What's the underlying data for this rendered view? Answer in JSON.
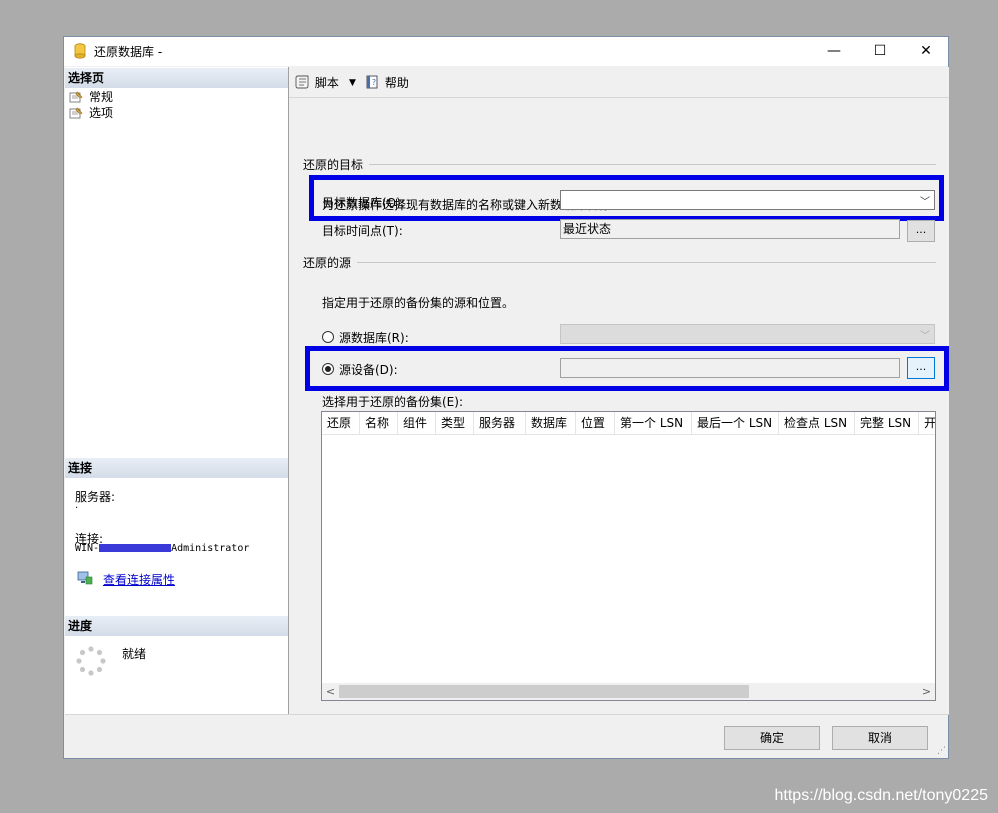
{
  "window": {
    "title": "还原数据库 -",
    "controls": {
      "minimize": "—",
      "maximize": "☐",
      "close": "✕"
    }
  },
  "left_pane": {
    "select_page_header": "选择页",
    "pages": [
      {
        "label": "常规",
        "icon": "page-settings-icon"
      },
      {
        "label": "选项",
        "icon": "page-settings-icon"
      }
    ],
    "connection_header": "连接",
    "server_label": "服务器:",
    "server_value": ".",
    "connection_label": "连接:",
    "connection_value_prefix": "WIN-",
    "connection_value_suffix": "Administrator",
    "view_connection_link": "查看连接属性",
    "progress_header": "进度",
    "progress_status": "就绪"
  },
  "toolbar": {
    "script_label": "脚本",
    "help_label": "帮助"
  },
  "restore_target": {
    "group_title": "还原的目标",
    "instruction": "为还原操作选择现有数据库的名称或键入新数据库名称。",
    "target_db_label": "目标数据库(O):",
    "target_db_value": "",
    "target_time_label": "目标时间点(T):",
    "target_time_value": "最近状态",
    "browse_label": "..."
  },
  "restore_source": {
    "group_title": "还原的源",
    "instruction": "指定用于还原的备份集的源和位置。",
    "source_db_label": "源数据库(R):",
    "source_device_label": "源设备(D):",
    "source_device_value": "",
    "browse_label": "...",
    "selected_option": "source_device"
  },
  "backup_sets": {
    "label": "选择用于还原的备份集(E):",
    "columns": [
      "还原",
      "名称",
      "组件",
      "类型",
      "服务器",
      "数据库",
      "位置",
      "第一个 LSN",
      "最后一个 LSN",
      "检查点 LSN",
      "完整 LSN",
      "开"
    ],
    "rows": []
  },
  "footer": {
    "ok_label": "确定",
    "cancel_label": "取消"
  },
  "watermark": "https://blog.csdn.net/tony0225",
  "colors": {
    "highlight": "#0000e6",
    "link": "#0000cc"
  }
}
